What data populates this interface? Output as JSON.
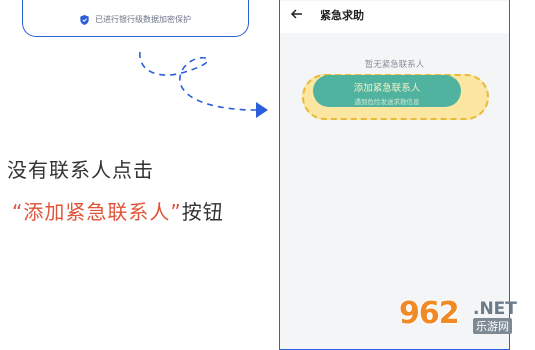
{
  "security_note": {
    "text": "已进行银行级数据加密保护",
    "icon": "shield-icon"
  },
  "instruction": {
    "line1": "没有联系人点击",
    "quote_open": "“",
    "highlight": "添加紧急联系人",
    "quote_close": "”",
    "suffix": "按钮"
  },
  "phone": {
    "back_icon": "arrow-left-icon",
    "title": "紧急求助",
    "empty_text": "暂无紧急联系人",
    "add_button": {
      "label": "添加紧急联系人",
      "subtext": "遇到危险发送求救信息"
    }
  },
  "watermark": {
    "number": "962",
    "domain": ".NET",
    "site_name": "乐游网"
  },
  "colors": {
    "frame_blue": "#2b5fd9",
    "highlight_red": "#e0553a",
    "button_teal": "#4fb3a0",
    "ring_yellow": "#e8b93a"
  }
}
